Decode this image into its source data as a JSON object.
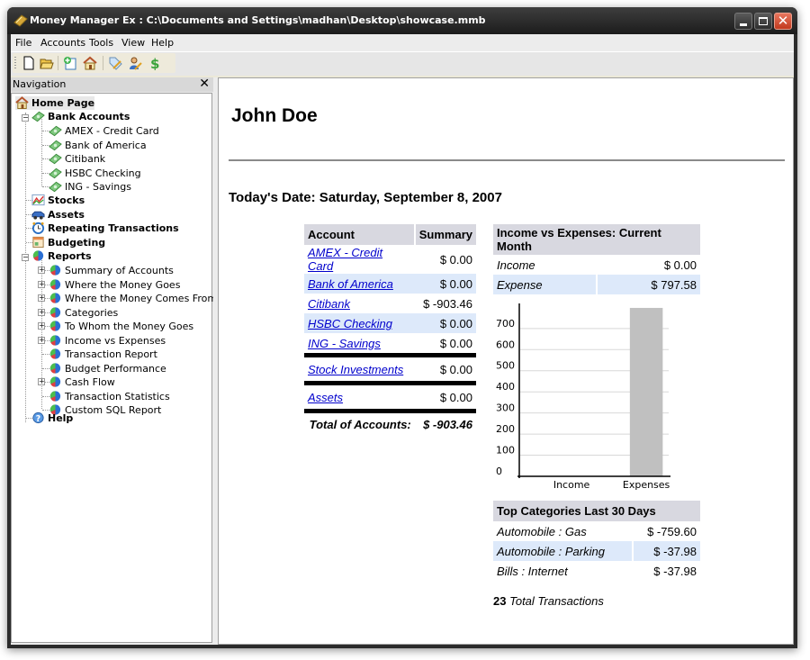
{
  "window": {
    "title": "Money Manager Ex : C:\\Documents and Settings\\madhan\\Desktop\\showcase.mmb"
  },
  "menu": [
    "File",
    "Accounts",
    "Tools",
    "View",
    "Help"
  ],
  "toolbar": {
    "icons": [
      "new-file-icon",
      "open-folder-icon",
      "new-account-icon",
      "home-icon",
      "tag-icon",
      "payee-icon",
      "currency-icon"
    ]
  },
  "navigation": {
    "title": "Navigation",
    "close": "✕",
    "home": "Home Page",
    "bank_accounts": "Bank Accounts",
    "accounts": [
      "AMEX - Credit Card",
      "Bank of America",
      "Citibank",
      "HSBC Checking",
      "ING - Savings"
    ],
    "stocks": "Stocks",
    "assets": "Assets",
    "repeating": "Repeating Transactions",
    "budgeting": "Budgeting",
    "reports": "Reports",
    "report_items": [
      {
        "label": "Summary of Accounts",
        "expandable": true
      },
      {
        "label": "Where the Money Goes",
        "expandable": true
      },
      {
        "label": "Where the Money Comes From",
        "expandable": true
      },
      {
        "label": "Categories",
        "expandable": true
      },
      {
        "label": "To Whom the Money Goes",
        "expandable": true
      },
      {
        "label": "Income vs Expenses",
        "expandable": true
      },
      {
        "label": "Transaction Report",
        "expandable": false
      },
      {
        "label": "Budget Performance",
        "expandable": false
      },
      {
        "label": "Cash Flow",
        "expandable": true
      },
      {
        "label": "Transaction Statistics",
        "expandable": false
      },
      {
        "label": "Custom SQL Report",
        "expandable": false
      }
    ],
    "help": "Help"
  },
  "home": {
    "user_name": "John Doe",
    "date_text": "Today's Date: Saturday, September 8, 2007",
    "accounts_table": {
      "headers": [
        "Account",
        "Summary"
      ],
      "bank_rows": [
        {
          "name": "AMEX - Credit Card",
          "value": "$ 0.00"
        },
        {
          "name": "Bank of America",
          "value": "$ 0.00"
        },
        {
          "name": "Citibank",
          "value": "$ -903.46"
        },
        {
          "name": "HSBC Checking",
          "value": "$ 0.00"
        },
        {
          "name": "ING - Savings",
          "value": "$ 0.00"
        }
      ],
      "stock_row": {
        "name": "Stock Investments",
        "value": "$ 0.00"
      },
      "assets_row": {
        "name": "Assets",
        "value": "$ 0.00"
      },
      "total_label": "Total of Accounts:",
      "total_value": "$ -903.46"
    },
    "income_expenses": {
      "header": "Income vs Expenses: Current Month",
      "rows": [
        {
          "label": "Income",
          "value": "$ 0.00"
        },
        {
          "label": "Expense",
          "value": "$ 797.58"
        }
      ]
    },
    "top_categories": {
      "header": "Top Categories Last 30 Days",
      "rows": [
        {
          "label": "Automobile : Gas",
          "value": "$ -759.60"
        },
        {
          "label": "Automobile : Parking",
          "value": "$ -37.98"
        },
        {
          "label": "Bills : Internet",
          "value": "$ -37.98"
        }
      ]
    },
    "total_transactions_count": "23",
    "total_transactions_label": "Total Transactions"
  },
  "chart_data": {
    "type": "bar",
    "title": "",
    "categories": [
      "Income",
      "Expenses"
    ],
    "values": [
      0,
      797.58
    ],
    "xlabel": "",
    "ylabel": "",
    "ylim": [
      0,
      800
    ],
    "yticks": [
      0,
      100,
      200,
      300,
      400,
      500,
      600,
      700
    ],
    "grid": true,
    "legend": "none",
    "bar_color": "#c0c0c0"
  }
}
